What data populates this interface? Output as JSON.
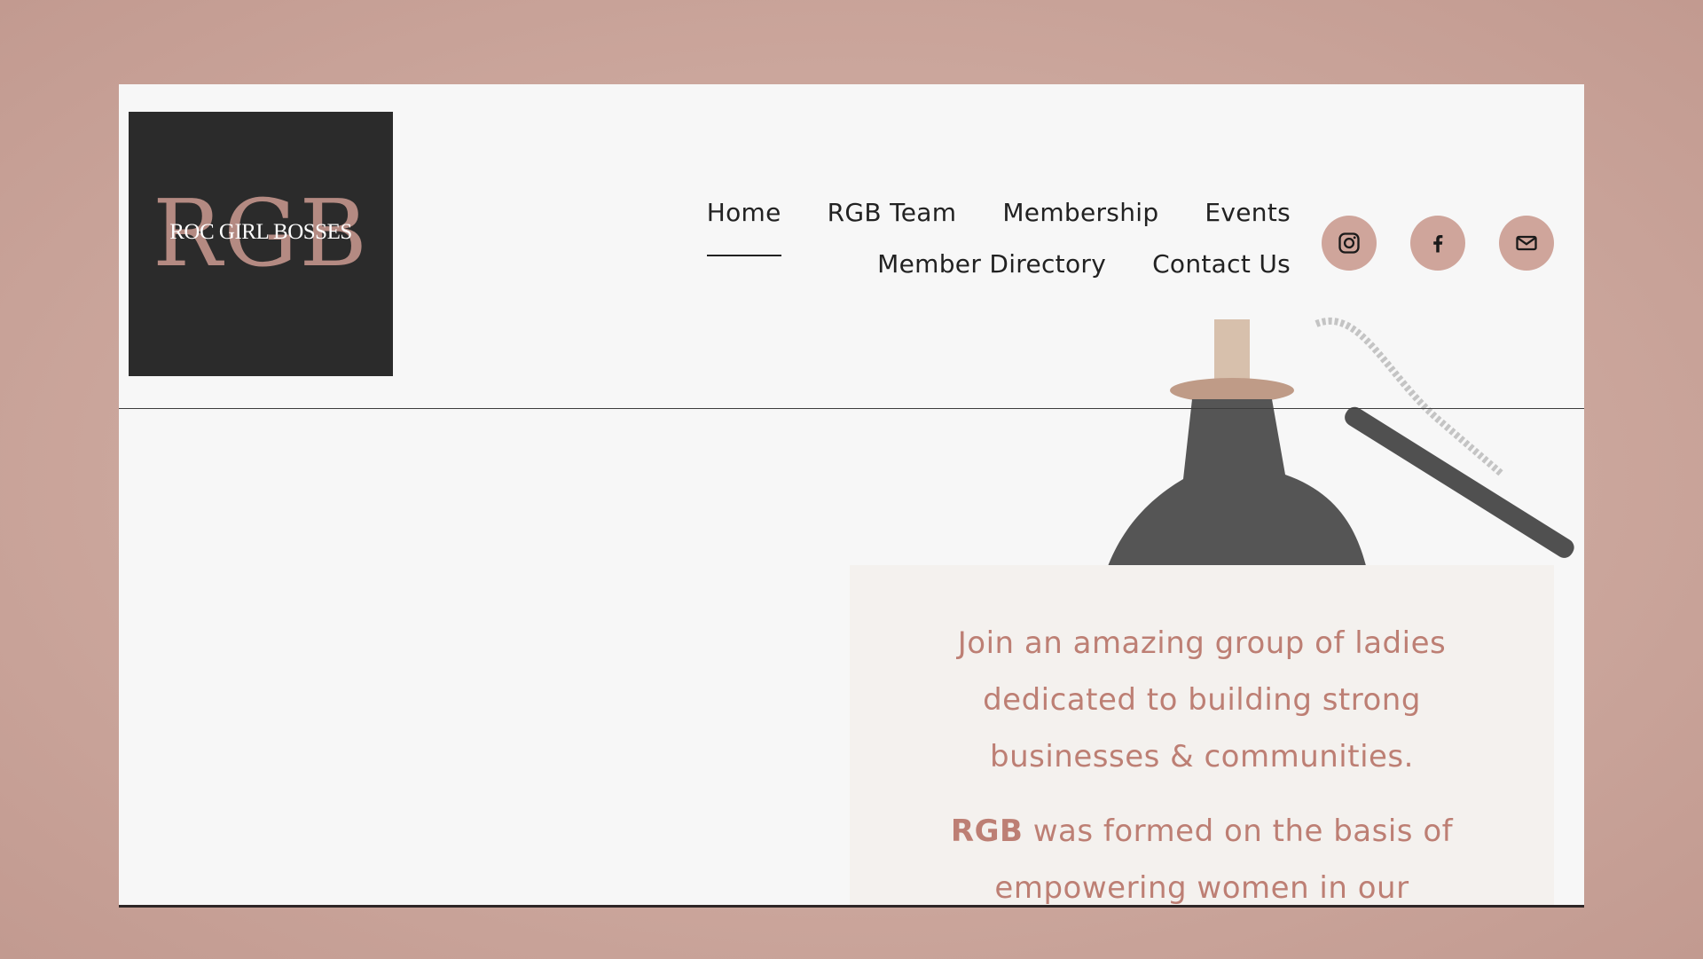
{
  "logo": {
    "mark": "RGB",
    "text": "ROC GIRL BOSSES"
  },
  "nav": {
    "row1": [
      "Home",
      "RGB Team",
      "Membership",
      "Events"
    ],
    "row2": [
      "Member Directory",
      "Contact Us"
    ],
    "active": "Home"
  },
  "socials": [
    {
      "name": "instagram-icon"
    },
    {
      "name": "facebook-icon"
    },
    {
      "name": "email-icon"
    }
  ],
  "hero": {
    "heading": "Join an amazing group of ladies dedicated to building strong businesses & communities.",
    "body_bold": "RGB",
    "body_rest": " was formed on the basis of empowering women in our"
  },
  "colors": {
    "backdrop": "#cfa89e",
    "accent": "#bd7f74",
    "social_bg": "#cfa59b",
    "logo_bg": "#2b2b2b"
  }
}
